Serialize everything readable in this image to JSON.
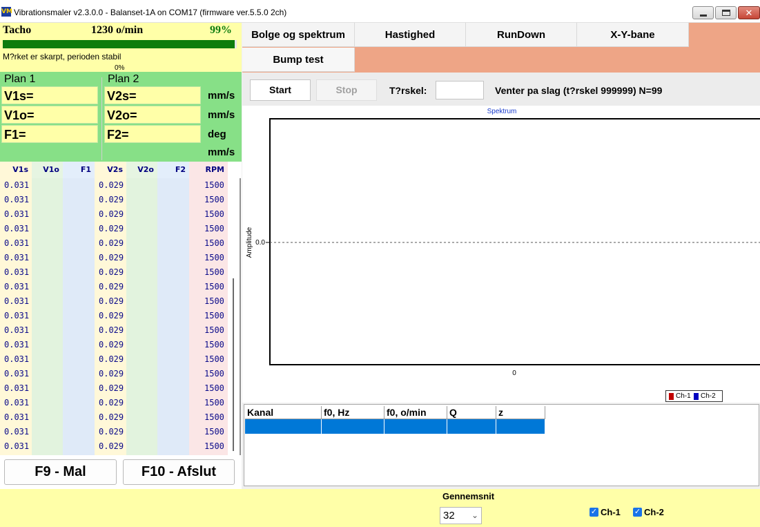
{
  "window": {
    "title": "Vibrationsmaler v2.3.0.0 - Balanset-1A on COM17 (firmware ver.5.5.0 2ch)",
    "icon": "VM",
    "controls": [
      "minimize-icon",
      "maximize-icon",
      "close-icon"
    ],
    "close_glyph": "✕"
  },
  "tacho": {
    "label": "Tacho",
    "rpm": "1230 o/min",
    "percent": "99%",
    "progress_fraction": 0.99,
    "message": "M?rket er skarpt, perioden stabil",
    "small_percent": "0%"
  },
  "plans": {
    "plan1_title": "Plan 1",
    "plan2_title": "Plan 2",
    "plan1": [
      "V1s=",
      "V1o=",
      "F1="
    ],
    "plan2": [
      "V2s=",
      "V2o=",
      "F2="
    ],
    "units": [
      "mm/s",
      "mm/s",
      "deg",
      "mm/s"
    ]
  },
  "table": {
    "headers": [
      "V1s",
      "V1o",
      "F1",
      "V2s",
      "V2o",
      "F2",
      "RPM"
    ],
    "rows": [
      [
        "0.031",
        "",
        "",
        "0.029",
        "",
        "",
        "1500"
      ],
      [
        "0.031",
        "",
        "",
        "0.029",
        "",
        "",
        "1500"
      ],
      [
        "0.031",
        "",
        "",
        "0.029",
        "",
        "",
        "1500"
      ],
      [
        "0.031",
        "",
        "",
        "0.029",
        "",
        "",
        "1500"
      ],
      [
        "0.031",
        "",
        "",
        "0.029",
        "",
        "",
        "1500"
      ],
      [
        "0.031",
        "",
        "",
        "0.029",
        "",
        "",
        "1500"
      ],
      [
        "0.031",
        "",
        "",
        "0.029",
        "",
        "",
        "1500"
      ],
      [
        "0.031",
        "",
        "",
        "0.029",
        "",
        "",
        "1500"
      ],
      [
        "0.031",
        "",
        "",
        "0.029",
        "",
        "",
        "1500"
      ],
      [
        "0.031",
        "",
        "",
        "0.029",
        "",
        "",
        "1500"
      ],
      [
        "0.031",
        "",
        "",
        "0.029",
        "",
        "",
        "1500"
      ],
      [
        "0.031",
        "",
        "",
        "0.029",
        "",
        "",
        "1500"
      ],
      [
        "0.031",
        "",
        "",
        "0.029",
        "",
        "",
        "1500"
      ],
      [
        "0.031",
        "",
        "",
        "0.029",
        "",
        "",
        "1500"
      ],
      [
        "0.031",
        "",
        "",
        "0.029",
        "",
        "",
        "1500"
      ],
      [
        "0.031",
        "",
        "",
        "0.029",
        "",
        "",
        "1500"
      ],
      [
        "0.031",
        "",
        "",
        "0.029",
        "",
        "",
        "1500"
      ],
      [
        "0.031",
        "",
        "",
        "0.029",
        "",
        "",
        "1500"
      ],
      [
        "0.031",
        "",
        "",
        "0.029",
        "",
        "",
        "1500"
      ]
    ]
  },
  "buttons": {
    "f9": "F9 - Mal",
    "f10": "F10 - Afslut",
    "start": "Start",
    "stop": "Stop"
  },
  "tabs": [
    "Bolge og spektrum",
    "Hastighed",
    "RunDown",
    "X-Y-bane",
    "Bump test"
  ],
  "toolbar": {
    "threshold_label": "T?rskel:",
    "threshold_value": "",
    "waiting": "Venter pa slag (t?rskel 999999)  N=99"
  },
  "chart_data": {
    "type": "line",
    "title": "Spektrum",
    "xlabel": "",
    "ylabel": "Amplitude",
    "x_tick_labels": [
      "0"
    ],
    "y_tick_labels": [
      "0.0"
    ],
    "series": [
      {
        "name": "Ch-1",
        "color": "#c00000",
        "values": []
      },
      {
        "name": "Ch-2",
        "color": "#0000c0",
        "values": []
      }
    ],
    "reference_line_y": 0.0,
    "legend_position": "bottom-right"
  },
  "results_grid": {
    "headers": [
      "Kanal",
      "f0, Hz",
      "f0, o/min",
      "Q",
      "z"
    ],
    "rows": [
      [
        "",
        "",
        "",
        "",
        ""
      ]
    ]
  },
  "bottom": {
    "average_label": "Gennemsnit",
    "average_value": "32",
    "checkboxes": [
      {
        "label": "Ch-1",
        "checked": true
      },
      {
        "label": "Ch-2",
        "checked": true
      }
    ]
  },
  "colors": {
    "yellow_panel": "#ffffa8",
    "green_panel": "#87e087",
    "tab_strip": "#eea586",
    "selection": "#0078d7",
    "progress": "#0d7c0d"
  }
}
